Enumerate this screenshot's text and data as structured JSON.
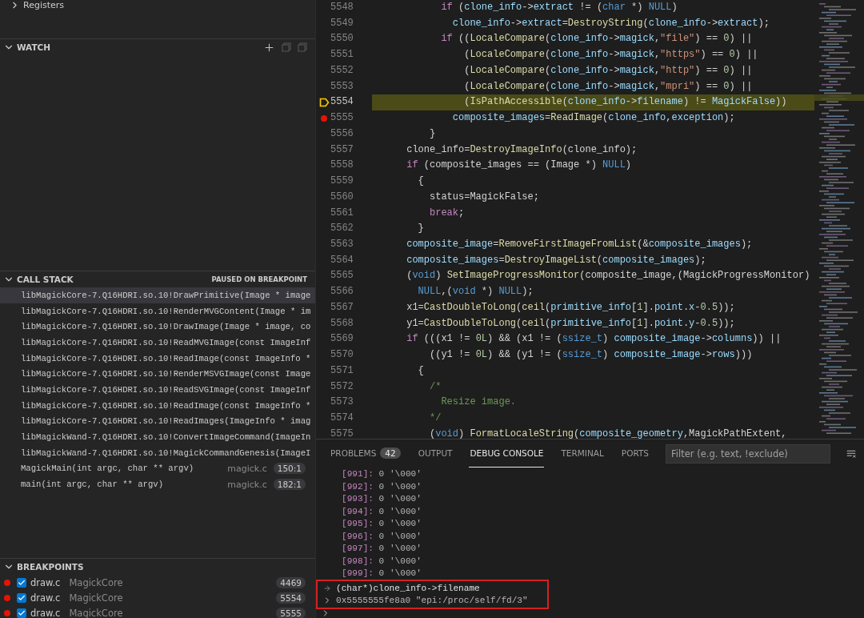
{
  "sidebar": {
    "variables": {
      "items": [
        {
          "label": "Registers",
          "expanded": false
        }
      ]
    },
    "watch": {
      "title": "WATCH"
    },
    "call_stack": {
      "title": "CALL STACK",
      "status": "PAUSED ON BREAKPOINT",
      "frames": [
        {
          "name": "libMagickCore-7.Q16HDRI.so.10!DrawPrimitive(Image * image",
          "selected": true
        },
        {
          "name": "libMagickCore-7.Q16HDRI.so.10!RenderMVGContent(Image * im",
          "selected": false
        },
        {
          "name": "libMagickCore-7.Q16HDRI.so.10!DrawImage(Image * image, co",
          "selected": false
        },
        {
          "name": "libMagickCore-7.Q16HDRI.so.10!ReadMVGImage(const ImageInf",
          "selected": false
        },
        {
          "name": "libMagickCore-7.Q16HDRI.so.10!ReadImage(const ImageInfo *",
          "selected": false
        },
        {
          "name": "libMagickCore-7.Q16HDRI.so.10!RenderMSVGImage(const Image",
          "selected": false
        },
        {
          "name": "libMagickCore-7.Q16HDRI.so.10!ReadSVGImage(const ImageInf",
          "selected": false
        },
        {
          "name": "libMagickCore-7.Q16HDRI.so.10!ReadImage(const ImageInfo *",
          "selected": false
        },
        {
          "name": "libMagickCore-7.Q16HDRI.so.10!ReadImages(ImageInfo * imag",
          "selected": false
        },
        {
          "name": "libMagickWand-7.Q16HDRI.so.10!ConvertImageCommand(ImageIn",
          "selected": false
        },
        {
          "name": "libMagickWand-7.Q16HDRI.so.10!MagickCommandGenesis(ImageI",
          "selected": false
        },
        {
          "name": "MagickMain(int argc, char ** argv)",
          "file": "magick.c",
          "position": "150:1",
          "selected": false
        },
        {
          "name": "main(int argc, char ** argv)",
          "file": "magick.c",
          "position": "182:1",
          "selected": false
        }
      ]
    },
    "breakpoints": {
      "title": "BREAKPOINTS",
      "items": [
        {
          "file": "draw.c",
          "folder": "MagickCore",
          "line": "4469",
          "checked": true
        },
        {
          "file": "draw.c",
          "folder": "MagickCore",
          "line": "5554",
          "checked": true
        },
        {
          "file": "draw.c",
          "folder": "MagickCore",
          "line": "5555",
          "checked": true
        }
      ]
    }
  },
  "editor": {
    "lines": [
      {
        "number": "5548",
        "breakpoint": false,
        "current": false,
        "tokens": [
          {
            "kind": "kw",
            "text": "            if"
          },
          {
            "kind": "p",
            "text": " ("
          },
          {
            "kind": "v",
            "text": "clone_info"
          },
          {
            "kind": "p",
            "text": "->"
          },
          {
            "kind": "v",
            "text": "extract"
          },
          {
            "kind": "p",
            "text": " != ("
          },
          {
            "kind": "ty",
            "text": "char"
          },
          {
            "kind": "p",
            "text": " *) "
          },
          {
            "kind": "ty",
            "text": "NULL"
          },
          {
            "kind": "p",
            "text": ")"
          }
        ]
      },
      {
        "number": "5549",
        "breakpoint": false,
        "current": false,
        "tokens": [
          {
            "kind": "v",
            "text": "              clone_info"
          },
          {
            "kind": "p",
            "text": "->"
          },
          {
            "kind": "v",
            "text": "extract"
          },
          {
            "kind": "p",
            "text": "="
          },
          {
            "kind": "fn",
            "text": "DestroyString"
          },
          {
            "kind": "p",
            "text": "("
          },
          {
            "kind": "v",
            "text": "clone_info"
          },
          {
            "kind": "p",
            "text": "->"
          },
          {
            "kind": "v",
            "text": "extract"
          },
          {
            "kind": "p",
            "text": ");"
          }
        ]
      },
      {
        "number": "5550",
        "breakpoint": false,
        "current": false,
        "tokens": [
          {
            "kind": "kw",
            "text": "            if"
          },
          {
            "kind": "p",
            "text": " (("
          },
          {
            "kind": "fn",
            "text": "LocaleCompare"
          },
          {
            "kind": "p",
            "text": "("
          },
          {
            "kind": "v",
            "text": "clone_info"
          },
          {
            "kind": "p",
            "text": "->"
          },
          {
            "kind": "v",
            "text": "magick"
          },
          {
            "kind": "p",
            "text": ","
          },
          {
            "kind": "s",
            "text": "\"file\""
          },
          {
            "kind": "p",
            "text": ") == "
          },
          {
            "kind": "n",
            "text": "0"
          },
          {
            "kind": "p",
            "text": ") ||"
          }
        ]
      },
      {
        "number": "5551",
        "breakpoint": false,
        "current": false,
        "tokens": [
          {
            "kind": "p",
            "text": "                ("
          },
          {
            "kind": "fn",
            "text": "LocaleCompare"
          },
          {
            "kind": "p",
            "text": "("
          },
          {
            "kind": "v",
            "text": "clone_info"
          },
          {
            "kind": "p",
            "text": "->"
          },
          {
            "kind": "v",
            "text": "magick"
          },
          {
            "kind": "p",
            "text": ","
          },
          {
            "kind": "s",
            "text": "\"https\""
          },
          {
            "kind": "p",
            "text": ") == "
          },
          {
            "kind": "n",
            "text": "0"
          },
          {
            "kind": "p",
            "text": ") ||"
          }
        ]
      },
      {
        "number": "5552",
        "breakpoint": false,
        "current": false,
        "tokens": [
          {
            "kind": "p",
            "text": "                ("
          },
          {
            "kind": "fn",
            "text": "LocaleCompare"
          },
          {
            "kind": "p",
            "text": "("
          },
          {
            "kind": "v",
            "text": "clone_info"
          },
          {
            "kind": "p",
            "text": "->"
          },
          {
            "kind": "v",
            "text": "magick"
          },
          {
            "kind": "p",
            "text": ","
          },
          {
            "kind": "s",
            "text": "\"http\""
          },
          {
            "kind": "p",
            "text": ") == "
          },
          {
            "kind": "n",
            "text": "0"
          },
          {
            "kind": "p",
            "text": ") ||"
          }
        ]
      },
      {
        "number": "5553",
        "breakpoint": false,
        "current": false,
        "tokens": [
          {
            "kind": "p",
            "text": "                ("
          },
          {
            "kind": "fn",
            "text": "LocaleCompare"
          },
          {
            "kind": "p",
            "text": "("
          },
          {
            "kind": "v",
            "text": "clone_info"
          },
          {
            "kind": "p",
            "text": "->"
          },
          {
            "kind": "v",
            "text": "magick"
          },
          {
            "kind": "p",
            "text": ","
          },
          {
            "kind": "s",
            "text": "\"mpri\""
          },
          {
            "kind": "p",
            "text": ") == "
          },
          {
            "kind": "n",
            "text": "0"
          },
          {
            "kind": "p",
            "text": ") ||"
          }
        ]
      },
      {
        "number": "5554",
        "breakpoint": false,
        "current": true,
        "tokens": [
          {
            "kind": "p",
            "text": "                ("
          },
          {
            "kind": "fn",
            "text": "IsPathAccessible"
          },
          {
            "kind": "p",
            "text": "("
          },
          {
            "kind": "v",
            "text": "clone_info"
          },
          {
            "kind": "p",
            "text": "->"
          },
          {
            "kind": "v",
            "text": "filename"
          },
          {
            "kind": "p",
            "text": ") != "
          },
          {
            "kind": "v",
            "text": "MagickFalse"
          },
          {
            "kind": "p",
            "text": "))"
          }
        ]
      },
      {
        "number": "5555",
        "breakpoint": true,
        "current": false,
        "tokens": [
          {
            "kind": "v",
            "text": "              composite_images"
          },
          {
            "kind": "p",
            "text": "="
          },
          {
            "kind": "fn",
            "text": "ReadImage"
          },
          {
            "kind": "p",
            "text": "("
          },
          {
            "kind": "v",
            "text": "clone_info"
          },
          {
            "kind": "p",
            "text": ","
          },
          {
            "kind": "v",
            "text": "exception"
          },
          {
            "kind": "p",
            "text": ");"
          }
        ]
      },
      {
        "number": "5556",
        "breakpoint": false,
        "current": false,
        "tokens": [
          {
            "kind": "p",
            "text": "          }"
          }
        ]
      },
      {
        "number": "5557",
        "breakpoint": false,
        "current": false,
        "tokens": [
          {
            "kind": "p",
            "text": "      clone_info="
          },
          {
            "kind": "fn",
            "text": "DestroyImageInfo"
          },
          {
            "kind": "p",
            "text": "(clone_info);"
          }
        ]
      },
      {
        "number": "5558",
        "breakpoint": false,
        "current": false,
        "tokens": [
          {
            "kind": "kw",
            "text": "      if"
          },
          {
            "kind": "p",
            "text": " (composite_images == (Image *) "
          },
          {
            "kind": "ty",
            "text": "NULL"
          },
          {
            "kind": "p",
            "text": ")"
          }
        ]
      },
      {
        "number": "5559",
        "breakpoint": false,
        "current": false,
        "tokens": [
          {
            "kind": "p",
            "text": "        {"
          }
        ]
      },
      {
        "number": "5560",
        "breakpoint": false,
        "current": false,
        "tokens": [
          {
            "kind": "p",
            "text": "          status=MagickFalse;"
          }
        ]
      },
      {
        "number": "5561",
        "breakpoint": false,
        "current": false,
        "tokens": [
          {
            "kind": "kw",
            "text": "          break"
          },
          {
            "kind": "p",
            "text": ";"
          }
        ]
      },
      {
        "number": "5562",
        "breakpoint": false,
        "current": false,
        "tokens": [
          {
            "kind": "p",
            "text": "        }"
          }
        ]
      },
      {
        "number": "5563",
        "breakpoint": false,
        "current": false,
        "tokens": [
          {
            "kind": "v",
            "text": "      composite_image"
          },
          {
            "kind": "p",
            "text": "="
          },
          {
            "kind": "fn",
            "text": "RemoveFirstImageFromList"
          },
          {
            "kind": "p",
            "text": "(&"
          },
          {
            "kind": "v",
            "text": "composite_images"
          },
          {
            "kind": "p",
            "text": ");"
          }
        ]
      },
      {
        "number": "5564",
        "breakpoint": false,
        "current": false,
        "tokens": [
          {
            "kind": "v",
            "text": "      composite_images"
          },
          {
            "kind": "p",
            "text": "="
          },
          {
            "kind": "fn",
            "text": "DestroyImageList"
          },
          {
            "kind": "p",
            "text": "("
          },
          {
            "kind": "v",
            "text": "composite_images"
          },
          {
            "kind": "p",
            "text": ");"
          }
        ]
      },
      {
        "number": "5565",
        "breakpoint": false,
        "current": false,
        "tokens": [
          {
            "kind": "p",
            "text": "      ("
          },
          {
            "kind": "ty",
            "text": "void"
          },
          {
            "kind": "p",
            "text": ") "
          },
          {
            "kind": "fn",
            "text": "SetImageProgressMonitor"
          },
          {
            "kind": "p",
            "text": "(composite_image,(MagickProgressMonitor)"
          }
        ]
      },
      {
        "number": "5566",
        "breakpoint": false,
        "current": false,
        "tokens": [
          {
            "kind": "ty",
            "text": "        NULL"
          },
          {
            "kind": "p",
            "text": ",("
          },
          {
            "kind": "ty",
            "text": "void"
          },
          {
            "kind": "p",
            "text": " *) "
          },
          {
            "kind": "ty",
            "text": "NULL"
          },
          {
            "kind": "p",
            "text": ");"
          }
        ]
      },
      {
        "number": "5567",
        "breakpoint": false,
        "current": false,
        "tokens": [
          {
            "kind": "p",
            "text": "      x1="
          },
          {
            "kind": "fn",
            "text": "CastDoubleToLong"
          },
          {
            "kind": "p",
            "text": "("
          },
          {
            "kind": "fn",
            "text": "ceil"
          },
          {
            "kind": "p",
            "text": "("
          },
          {
            "kind": "v",
            "text": "primitive_info"
          },
          {
            "kind": "p",
            "text": "["
          },
          {
            "kind": "n",
            "text": "1"
          },
          {
            "kind": "p",
            "text": "]."
          },
          {
            "kind": "v",
            "text": "point"
          },
          {
            "kind": "p",
            "text": "."
          },
          {
            "kind": "v",
            "text": "x"
          },
          {
            "kind": "p",
            "text": "-"
          },
          {
            "kind": "n",
            "text": "0.5"
          },
          {
            "kind": "p",
            "text": "));"
          }
        ]
      },
      {
        "number": "5568",
        "breakpoint": false,
        "current": false,
        "tokens": [
          {
            "kind": "p",
            "text": "      y1="
          },
          {
            "kind": "fn",
            "text": "CastDoubleToLong"
          },
          {
            "kind": "p",
            "text": "("
          },
          {
            "kind": "fn",
            "text": "ceil"
          },
          {
            "kind": "p",
            "text": "("
          },
          {
            "kind": "v",
            "text": "primitive_info"
          },
          {
            "kind": "p",
            "text": "["
          },
          {
            "kind": "n",
            "text": "1"
          },
          {
            "kind": "p",
            "text": "]."
          },
          {
            "kind": "v",
            "text": "point"
          },
          {
            "kind": "p",
            "text": "."
          },
          {
            "kind": "v",
            "text": "y"
          },
          {
            "kind": "p",
            "text": "-"
          },
          {
            "kind": "n",
            "text": "0.5"
          },
          {
            "kind": "p",
            "text": "));"
          }
        ]
      },
      {
        "number": "5569",
        "breakpoint": false,
        "current": false,
        "tokens": [
          {
            "kind": "kw",
            "text": "      if"
          },
          {
            "kind": "p",
            "text": " (((x1 != "
          },
          {
            "kind": "n",
            "text": "0L"
          },
          {
            "kind": "p",
            "text": ") && (x1 != ("
          },
          {
            "kind": "ty",
            "text": "ssize_t"
          },
          {
            "kind": "p",
            "text": ") "
          },
          {
            "kind": "v",
            "text": "composite_image"
          },
          {
            "kind": "p",
            "text": "->"
          },
          {
            "kind": "v",
            "text": "columns"
          },
          {
            "kind": "p",
            "text": ")) ||"
          }
        ]
      },
      {
        "number": "5570",
        "breakpoint": false,
        "current": false,
        "tokens": [
          {
            "kind": "p",
            "text": "          ((y1 != "
          },
          {
            "kind": "n",
            "text": "0L"
          },
          {
            "kind": "p",
            "text": ") && (y1 != ("
          },
          {
            "kind": "ty",
            "text": "ssize_t"
          },
          {
            "kind": "p",
            "text": ") "
          },
          {
            "kind": "v",
            "text": "composite_image"
          },
          {
            "kind": "p",
            "text": "->"
          },
          {
            "kind": "v",
            "text": "rows"
          },
          {
            "kind": "p",
            "text": ")))"
          }
        ]
      },
      {
        "number": "5571",
        "breakpoint": false,
        "current": false,
        "tokens": [
          {
            "kind": "p",
            "text": "        {"
          }
        ]
      },
      {
        "number": "5572",
        "breakpoint": false,
        "current": false,
        "tokens": [
          {
            "kind": "c",
            "text": "          /*"
          }
        ]
      },
      {
        "number": "5573",
        "breakpoint": false,
        "current": false,
        "tokens": [
          {
            "kind": "c",
            "text": "            Resize image."
          }
        ]
      },
      {
        "number": "5574",
        "breakpoint": false,
        "current": false,
        "tokens": [
          {
            "kind": "c",
            "text": "          */"
          }
        ]
      },
      {
        "number": "5575",
        "breakpoint": false,
        "current": false,
        "tokens": [
          {
            "kind": "p",
            "text": "          ("
          },
          {
            "kind": "ty",
            "text": "void"
          },
          {
            "kind": "p",
            "text": ") "
          },
          {
            "kind": "fn",
            "text": "FormatLocaleString"
          },
          {
            "kind": "p",
            "text": "("
          },
          {
            "kind": "v",
            "text": "composite_geometry"
          },
          {
            "kind": "p",
            "text": ",MagickPathExtent,"
          }
        ]
      }
    ]
  },
  "panel": {
    "tabs": [
      {
        "label": "PROBLEMS",
        "badge": "42",
        "selected": false
      },
      {
        "label": "OUTPUT",
        "selected": false
      },
      {
        "label": "DEBUG CONSOLE",
        "selected": true
      },
      {
        "label": "TERMINAL",
        "selected": false
      },
      {
        "label": "PORTS",
        "selected": false
      }
    ],
    "filter": {
      "placeholder": "Filter (e.g. text, !exclude)"
    },
    "console": {
      "lines": [
        {
          "index": "[991]:",
          "value": "0 '\\000'"
        },
        {
          "index": "[992]:",
          "value": "0 '\\000'"
        },
        {
          "index": "[993]:",
          "value": "0 '\\000'"
        },
        {
          "index": "[994]:",
          "value": "0 '\\000'"
        },
        {
          "index": "[995]:",
          "value": "0 '\\000'"
        },
        {
          "index": "[996]:",
          "value": "0 '\\000'"
        },
        {
          "index": "[997]:",
          "value": "0 '\\000'"
        },
        {
          "index": "[998]:",
          "value": "0 '\\000'"
        },
        {
          "index": "[999]:",
          "value": "0 '\\000'"
        }
      ],
      "highlighted": [
        {
          "kind": "input",
          "text": "(char*)clone_info->filename"
        },
        {
          "kind": "result",
          "text": "0x5555555fe8a0 \"epi:/proc/self/fd/3\""
        }
      ]
    }
  }
}
